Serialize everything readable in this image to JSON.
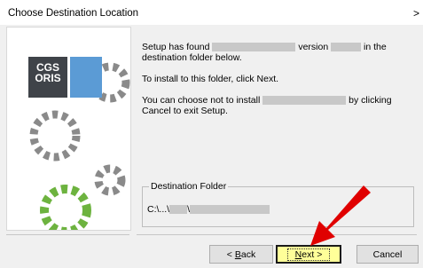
{
  "window": {
    "title": "Choose Destination Location",
    "close_glyph": ">"
  },
  "logo": {
    "line1": "CGS",
    "line2": "ORIS"
  },
  "messages": {
    "found_prefix": "Setup has found",
    "found_middle": "version",
    "found_suffix": "in the",
    "found_line2": "destination folder below.",
    "install_line": "To install to this folder, click Next.",
    "choose_prefix": "You can choose not to install",
    "choose_suffix": "by clicking",
    "choose_line2": "Cancel to exit Setup."
  },
  "destination": {
    "label": "Destination Folder",
    "path_prefix": "C:\\...\\",
    "path_sep": "\\"
  },
  "buttons": {
    "back": {
      "pre": "< ",
      "key": "B",
      "rest": "ack"
    },
    "next": {
      "key": "N",
      "rest": "ext >"
    },
    "cancel": "Cancel"
  },
  "colors": {
    "highlight": "#ffff99",
    "arrow": "#e00000",
    "logo_dark": "#3f4349",
    "logo_blue": "#5b9bd5",
    "gear_green": "#6db33f",
    "gear_gray": "#8a8a8a"
  }
}
